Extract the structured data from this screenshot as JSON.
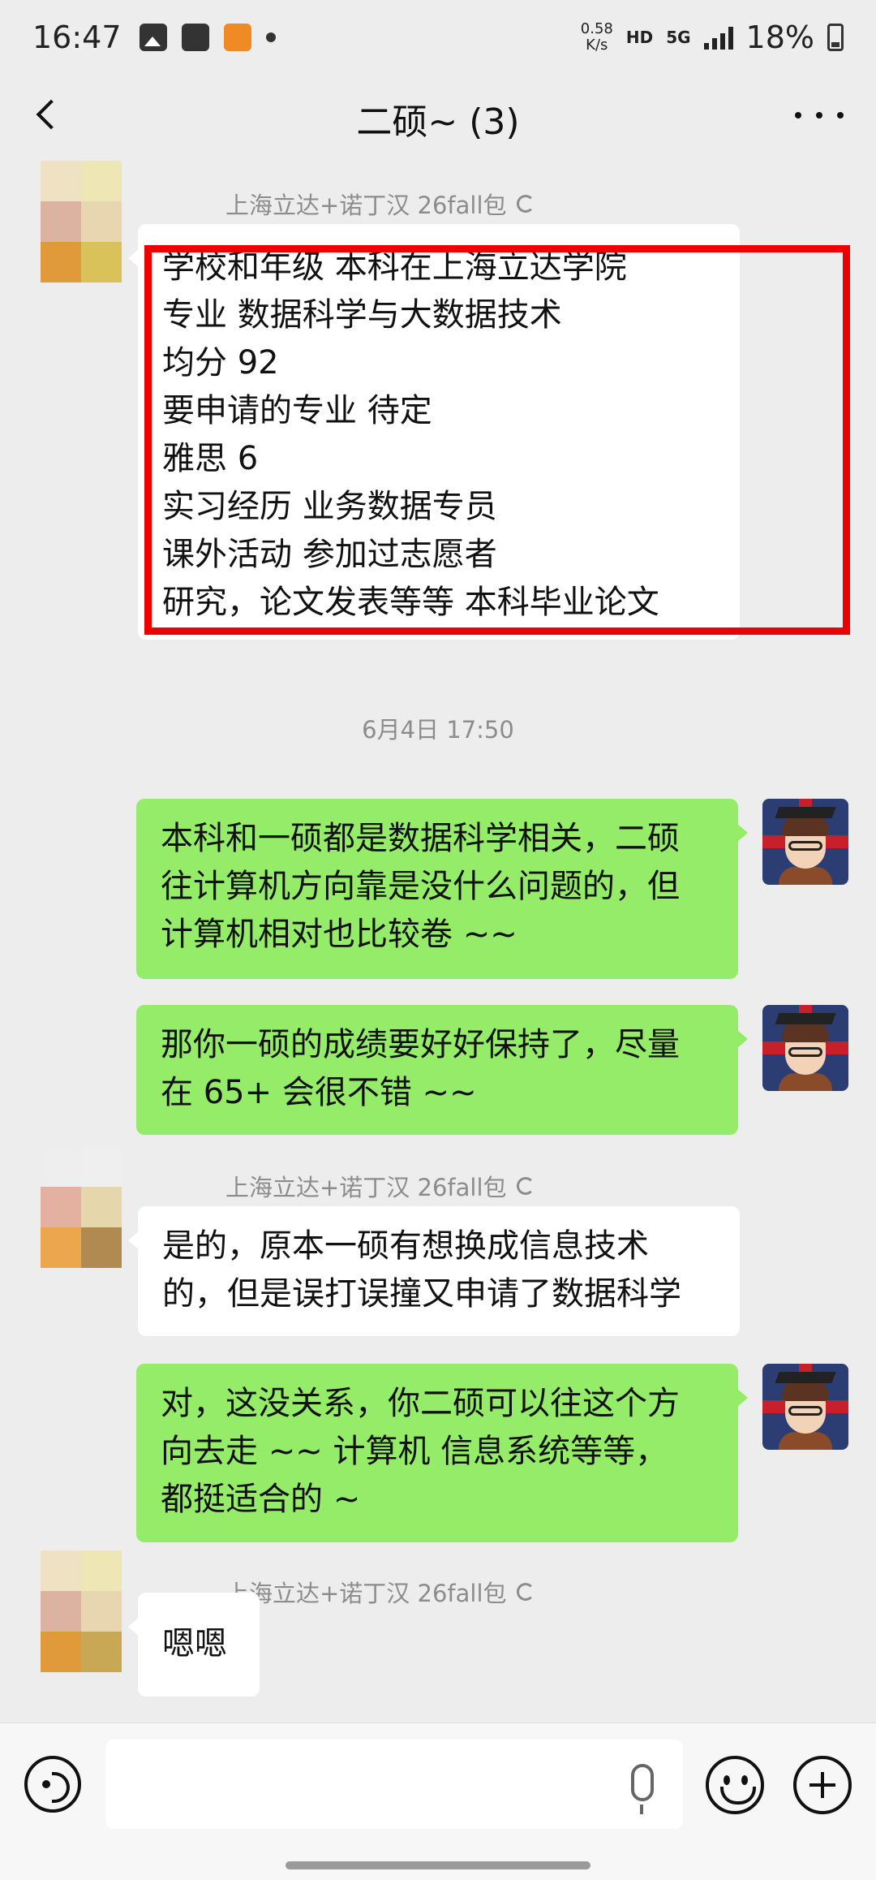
{
  "status_bar": {
    "time": "16:47",
    "speed_value": "0.58",
    "speed_unit": "K/s",
    "hd": "HD",
    "network": "5G",
    "battery": "18%"
  },
  "header": {
    "title": "二硕~ (3)"
  },
  "messages": [
    {
      "side": "left",
      "sender": "上海立达+诺丁汉  26fall包",
      "lines": [
        "学校和年级 本科在上海立达学院",
        "专业 数据科学与大数据技术",
        "均分 92",
        "要申请的专业 待定",
        "雅思 6",
        "实习经历 业务数据专员",
        "课外活动 参加过志愿者",
        "研究，论文发表等等 本科毕业论文"
      ]
    },
    {
      "side": "right",
      "lines": [
        "本科和一硕都是数据科学相关，二硕",
        "往计算机方向靠是没什么问题的，但",
        "计算机相对也比较卷 ~~"
      ]
    },
    {
      "side": "right",
      "lines": [
        "那你一硕的成绩要好好保持了，尽量",
        "在 65+ 会很不错 ~~"
      ]
    },
    {
      "side": "left",
      "sender": "上海立达+诺丁汉  26fall包",
      "lines": [
        "是的，原本一硕有想换成信息技术",
        "的，但是误打误撞又申请了数据科学"
      ]
    },
    {
      "side": "right",
      "lines": [
        "对，这没关系，你二硕可以往这个方",
        "向去走 ~~ 计算机  信息系统等等，",
        "都挺适合的 ~"
      ]
    },
    {
      "side": "left",
      "sender": "上海立达+诺丁汉  26fall包",
      "lines": [
        "嗯嗯"
      ]
    }
  ],
  "timestamp": "6月4日 17:50",
  "colors": {
    "background": "#ededed",
    "bubble_self": "#95ec69",
    "bubble_other": "#ffffff",
    "highlight": "#ee0000"
  },
  "icons": {
    "back": "chevron-left-icon",
    "more": "more-dots-icon",
    "voice": "voice-icon",
    "mic": "mic-icon",
    "emoji": "emoji-icon",
    "plus": "plus-icon"
  }
}
